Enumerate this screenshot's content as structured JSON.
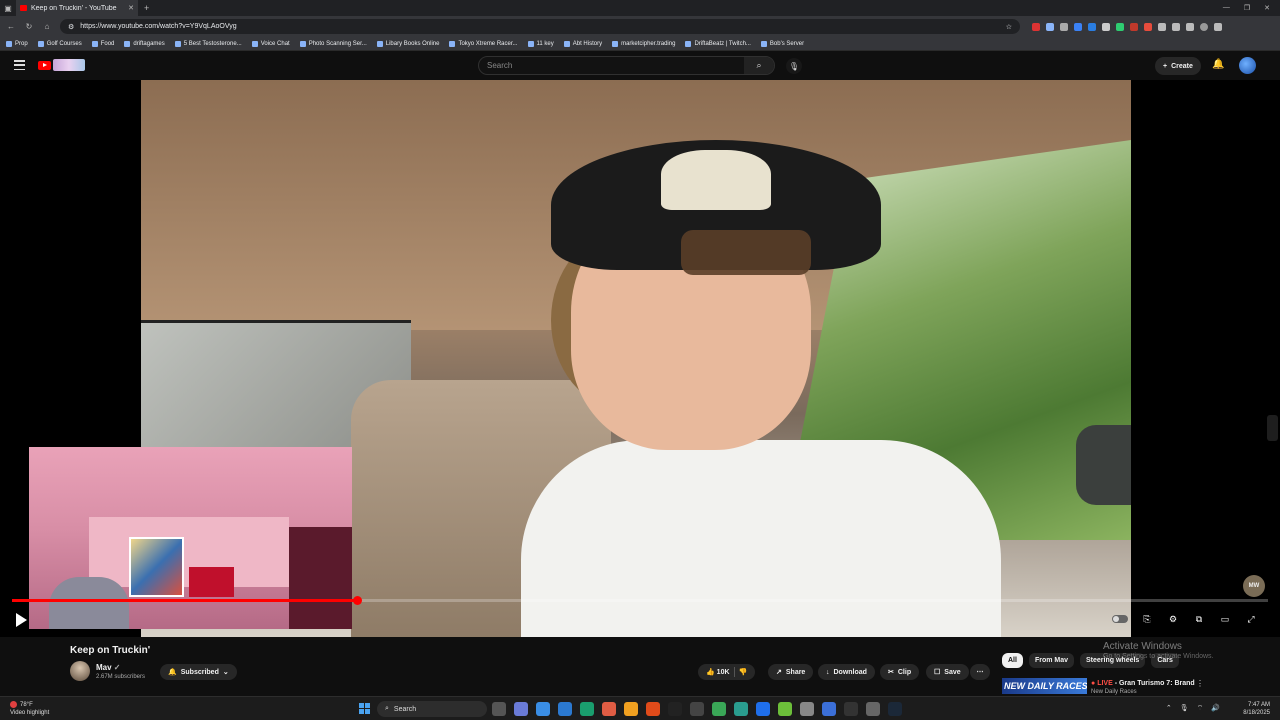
{
  "browser": {
    "tab_title": "Keep on Truckin' - YouTube",
    "url": "https://www.youtube.com/watch?v=Y9VqLAoOVyg",
    "bookmarks": [
      "Prop",
      "Golf Courses",
      "Food",
      "driftagames",
      "5 Best Testosterone...",
      "Voice Chat",
      "Photo Scanning Ser...",
      "Libary Books Online",
      "Tokyo Xtreme Racer...",
      "11 key",
      "Abt History",
      "marketcipher.trading",
      "DriftaBeatz | Twitch...",
      "Bob's Server"
    ]
  },
  "header": {
    "search_placeholder": "Search",
    "create_label": "Create"
  },
  "player": {
    "progress_fraction": 0.275,
    "watermark": "MW"
  },
  "video": {
    "title": "Keep on Truckin'",
    "channel": "Mav",
    "subscribers": "2.67M subscribers",
    "subscribed_label": "Subscribed",
    "likes": "10K",
    "share_label": "Share",
    "download_label": "Download",
    "clip_label": "Clip",
    "save_label": "Save"
  },
  "chips": [
    "All",
    "From Mav",
    "Steering wheels",
    "Cars"
  ],
  "overlay": {
    "activate_title": "Activate Windows",
    "activate_sub": "Go to Settings to activate Windows."
  },
  "recommendation": {
    "thumb_text": "NEW DAILY RACES",
    "live": "LIVE",
    "title": "- Gran Turismo 7: Brand",
    "subtitle": "New Daily Races"
  },
  "taskbar": {
    "weather_temp": "78°F",
    "weather_text": "Video highlight",
    "search_label": "Search",
    "time": "7:47 AM",
    "date": "8/18/2025"
  }
}
